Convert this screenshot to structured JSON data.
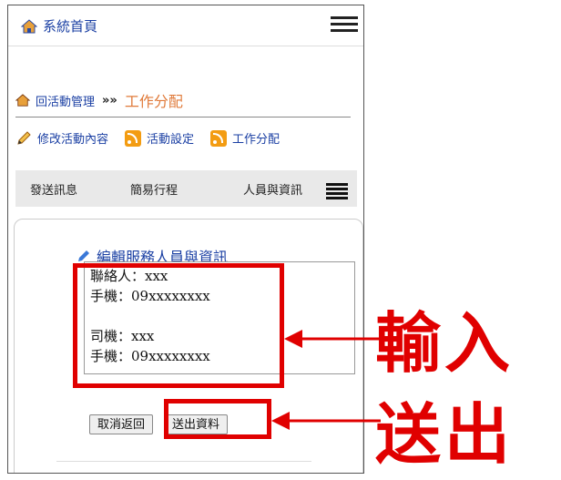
{
  "app": {
    "title": "系統首頁"
  },
  "breadcrumb": {
    "back_label": "回活動管理",
    "separator": "»»",
    "current": "工作分配"
  },
  "actions": [
    {
      "label": "修改活動內容",
      "icon": "pencil-icon"
    },
    {
      "label": "活動設定",
      "icon": "rss-icon"
    },
    {
      "label": "工作分配",
      "icon": "rss-icon"
    }
  ],
  "tabs": [
    "發送訊息",
    "簡易行程",
    "人員與資訊"
  ],
  "panel": {
    "title": "編輯服務人員與資訊",
    "textarea_value": "聯絡人：xxx\n手機：09xxxxxxxx\n\n司機：xxx\n手機：09xxxxxxxx",
    "cancel_label": "取消返回",
    "submit_label": "送出資料"
  },
  "annotations": {
    "input_label": "輸入",
    "submit_label": "送出",
    "color": "#e00000"
  }
}
